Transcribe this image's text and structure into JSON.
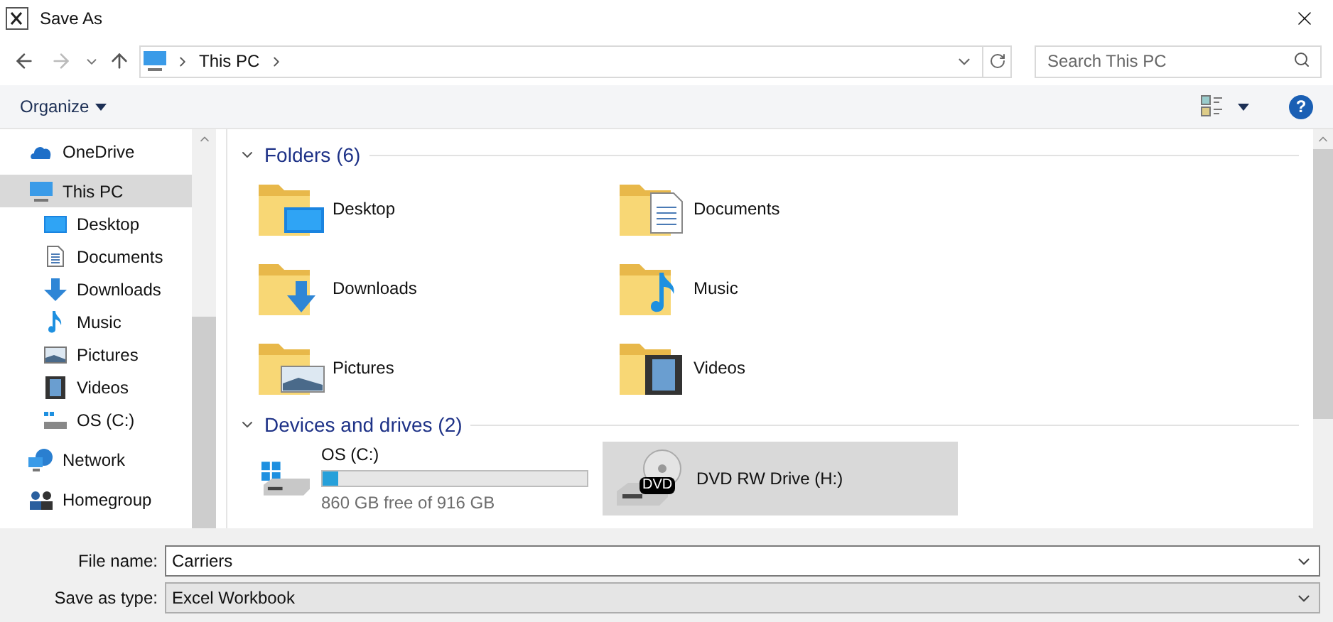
{
  "window": {
    "title": "Save As"
  },
  "address": {
    "crumbs": [
      "This PC"
    ],
    "search_placeholder": "Search This PC"
  },
  "toolbar": {
    "organize": "Organize",
    "help": "?"
  },
  "sidebar": {
    "items": [
      {
        "label": "OneDrive",
        "kind": "cloud",
        "selected": false
      },
      {
        "label": "This PC",
        "kind": "pc",
        "selected": true,
        "children": [
          {
            "label": "Desktop",
            "kind": "desktop",
            "selected": false
          },
          {
            "label": "Documents",
            "kind": "documents",
            "selected": false
          },
          {
            "label": "Downloads",
            "kind": "downloads",
            "selected": false
          },
          {
            "label": "Music",
            "kind": "music",
            "selected": false
          },
          {
            "label": "Pictures",
            "kind": "pictures",
            "selected": false
          },
          {
            "label": "Videos",
            "kind": "videos",
            "selected": false
          },
          {
            "label": "OS (C:)",
            "kind": "drive",
            "selected": false
          }
        ]
      },
      {
        "label": "Network",
        "kind": "network",
        "selected": false
      },
      {
        "label": "Homegroup",
        "kind": "homegroup",
        "selected": false
      }
    ]
  },
  "folders": {
    "heading": "Folders (6)",
    "items": [
      {
        "label": "Desktop",
        "kind": "desktop"
      },
      {
        "label": "Documents",
        "kind": "documents"
      },
      {
        "label": "Downloads",
        "kind": "downloads"
      },
      {
        "label": "Music",
        "kind": "music"
      },
      {
        "label": "Pictures",
        "kind": "pictures"
      },
      {
        "label": "Videos",
        "kind": "videos"
      }
    ]
  },
  "devices": {
    "heading": "Devices and drives (2)",
    "items": [
      {
        "label": "OS (C:)",
        "kind": "hdd",
        "level": 0.06,
        "free": "860 GB free of 916 GB",
        "selected": false
      },
      {
        "label": "DVD RW Drive (H:)",
        "kind": "dvd",
        "badge": "DVD",
        "selected": true
      }
    ]
  },
  "form": {
    "fields": [
      {
        "label": "File name:",
        "value": "Carriers"
      },
      {
        "label": "Save as type:",
        "value": "Excel Workbook"
      }
    ]
  }
}
